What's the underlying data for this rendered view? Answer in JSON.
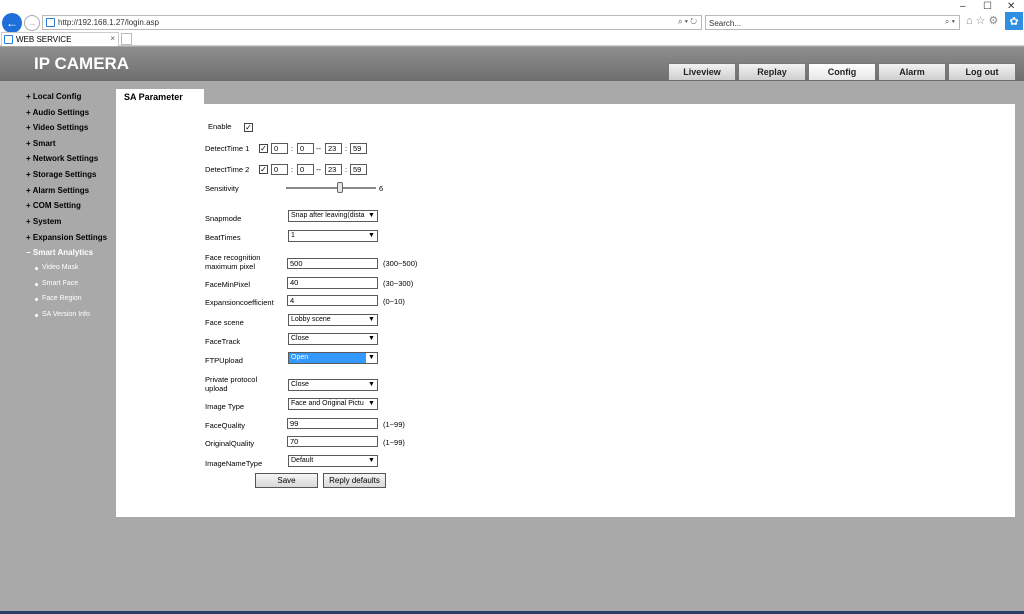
{
  "browser": {
    "address_url": "http://192.168.1.27/login.asp",
    "search_placeholder": "Search...",
    "tab_title": "WEB SERVICE",
    "tab_close": "×",
    "minimize": "–",
    "maximize": "☐",
    "close": "✕"
  },
  "app": {
    "title": "IP CAMERA",
    "nav_tabs": [
      "Liveview",
      "Replay",
      "Config",
      "Alarm",
      "Log out"
    ],
    "active_tab": "Config"
  },
  "sidebar": {
    "items": [
      "+ Local Config",
      "+ Audio Settings",
      "+ Video Settings",
      "+ Smart",
      "+ Network Settings",
      "+ Storage Settings",
      "+ Alarm Settings",
      "+ COM Setting",
      "+ System",
      "+ Expansion Settings",
      "− Smart Analytics"
    ],
    "subitems": [
      "Video Mask",
      "Smart Face",
      "Face Region",
      "SA Version Info"
    ]
  },
  "panel": {
    "title": "SA Parameter",
    "enable_label": "Enable",
    "detect1_label": "DetectTime 1",
    "detect2_label": "DetectTime 2",
    "detect1": {
      "h1": "0",
      "m1": "0",
      "h2": "23",
      "m2": "59"
    },
    "detect2": {
      "h1": "0",
      "m1": "0",
      "h2": "23",
      "m2": "59"
    },
    "time_colon": ":",
    "time_dash": "--",
    "sensitivity_label": "Sensitivity",
    "sensitivity_value": "6",
    "snapmode_label": "Snapmode",
    "snapmode_value": "Snap after leaving(dista",
    "beattimes_label": "BeatTimes",
    "beattimes_value": "1",
    "facemax_label_1": "Face recognition",
    "facemax_label_2": "maximum pixel",
    "facemax_value": "500",
    "facemax_range": "(300~500)",
    "facemin_label": "FaceMinPixel",
    "facemin_value": "40",
    "facemin_range": "(30~300)",
    "expcoef_label": "Expansioncoefficient",
    "expcoef_value": "4",
    "expcoef_range": "(0~10)",
    "facescene_label": "Face scene",
    "facescene_value": "Lobby scene",
    "facetrack_label": "FaceTrack",
    "facetrack_value": "Close",
    "ftp_label": "FTPUpload",
    "ftp_value": "Open",
    "private_label_1": "Private protocol",
    "private_label_2": "upload",
    "private_value": "Close",
    "imagetype_label": "Image Type",
    "imagetype_value": "Face and Original Pictu",
    "facequality_label": "FaceQuality",
    "facequality_value": "99",
    "facequality_range": "(1~99)",
    "origquality_label": "OriginalQuality",
    "origquality_value": "70",
    "origquality_range": "(1~99)",
    "imagename_label": "ImageNameType",
    "imagename_value": "Default",
    "save_label": "Save",
    "reply_label": "Reply defaults",
    "check_mark": "✓",
    "arrow": "▼"
  },
  "colors": {
    "highlight": "#3399ff",
    "header": "#7e7e7e",
    "background": "#a9a9a9"
  }
}
